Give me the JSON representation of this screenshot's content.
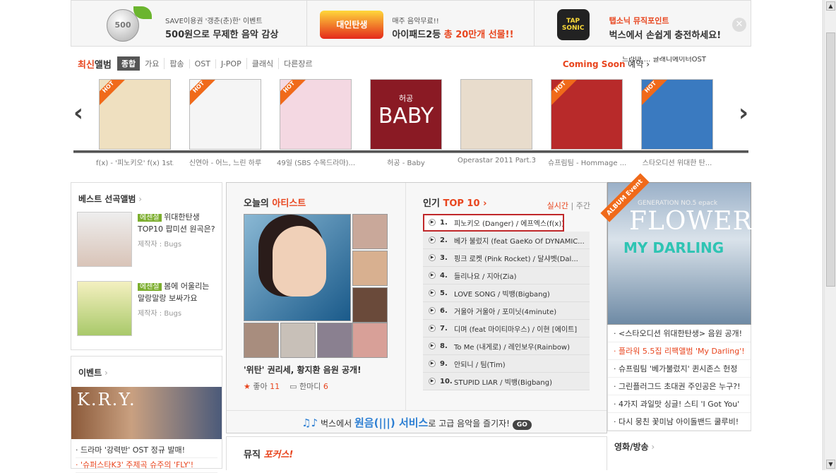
{
  "banner": {
    "coin": "500",
    "item1_small": "SAVE이용권 '갱춘(춘)한' 이벤트",
    "item1_big": "500원으로 무제한 음악 감상",
    "item2_logo": "대인탄생",
    "item2_small": "매주 음악무료!!",
    "item2_big_pre": "아이패드2등 ",
    "item2_big_hl": "총 20만개 선물!!",
    "item3_logo": "TAP SONIC",
    "item3_small": "탭소닉 뮤직포인트",
    "item3_big": "벅스에서 손쉽게 충전하세요!",
    "close": "✕"
  },
  "newest": {
    "title_hl": "최신",
    "title": "앨범",
    "tabs": [
      "종합",
      "가요",
      "팝송",
      "OST",
      "J-POP",
      "클래식",
      "다른장르"
    ],
    "coming_soon": "Coming Soon",
    "coming_soon_suffix": " 예약 ›",
    "ost_text": "드라마 ...\n글래디에이터OST"
  },
  "albums": [
    {
      "caption": "f(x) - '피노키오' f(x) 1st...",
      "hot": "HOT",
      "color": "#efe0c0"
    },
    {
      "caption": "신연아 - 어느, 느린 하루",
      "hot": "HOT",
      "color": "#f5f5f5"
    },
    {
      "caption": "49일 (SBS 수목드라마)...",
      "hot": "HOT",
      "color": "#f4d8e2"
    },
    {
      "caption": "허공 - Baby",
      "hot": "",
      "color": "#8a1a24"
    },
    {
      "caption": "Operastar 2011 Part.3(...",
      "hot": "",
      "color": "#e8dccc"
    },
    {
      "caption": "슈프림팀 - Hommage ...",
      "hot": "HOT",
      "color": "#b82a2a"
    },
    {
      "caption": "스타오디션 위대한 탄...",
      "hot": "HOT",
      "color": "#3a7ac0"
    }
  ],
  "album_cover_text": {
    "baby": "BABY",
    "baby_top": "허공"
  },
  "nav": {
    "prev": "‹",
    "next": "›"
  },
  "best": {
    "title": "베스트 선곡앨범",
    "items": [
      {
        "tag": "에센셜",
        "text": " 위대한탄생 TOP10 팝미션 원곡은?",
        "maker": "제작자 : Bugs"
      },
      {
        "tag": "에센셜",
        "text": " 봄에 어울리는 말랑말랑 보싸가요",
        "maker": "제작자 : Bugs"
      }
    ]
  },
  "events": {
    "title": "이벤트",
    "image_text": "K.R.Y.",
    "items": [
      "드라마 '강력반' OST 정규 발매!",
      "'슈퍼스타K3' 주제곡 슈주의 'FLY'!"
    ]
  },
  "artist": {
    "title_pre": "오늘의 ",
    "title_hl": "아티스트",
    "caption": "'위탄' 권리세, 황지환 음원 공개!",
    "like_label": "좋아",
    "likes": "11",
    "comment_label": "한마디",
    "comments": "6"
  },
  "top10": {
    "title_pre": "인기 ",
    "title_hl": "TOP 10",
    "arrow": "›",
    "opt_realtime": "실시간",
    "opt_weekly": "주간",
    "rows": [
      {
        "rank": "1.",
        "title": "피노키오 (Danger) / 에프엑스(f(x))"
      },
      {
        "rank": "2.",
        "title": "베가 불렀지 (feat GaeKo Of DYNAMIC..."
      },
      {
        "rank": "3.",
        "title": "핑크 로켓 (Pink Rocket) / 달샤벳(Dal..."
      },
      {
        "rank": "4.",
        "title": "들리나요 / 지아(Zia)"
      },
      {
        "rank": "5.",
        "title": "LOVE SONG / 빅뱅(Bigbang)"
      },
      {
        "rank": "6.",
        "title": "거울아 거울아 / 포미닛(4minute)"
      },
      {
        "rank": "7.",
        "title": "디며 (feat 마이티마우스) / 이현 [에이트]"
      },
      {
        "rank": "8.",
        "title": "To Me (내게로) / 레인보우(Rainbow)"
      },
      {
        "rank": "9.",
        "title": "안되니 / 팀(Tim)"
      },
      {
        "rank": "10.",
        "title": "STUPID LIAR / 빅뱅(Bigbang)"
      }
    ]
  },
  "promo": {
    "notes": "♫♪",
    "pre": "벅스에서 ",
    "hl1": "원음(",
    "hl2": ") 서비스",
    "post": "로 고급 음악을 즐기자!",
    "go": "GO"
  },
  "music_focus": {
    "title": "뮤직 ",
    "title_hl": "포커스!"
  },
  "right": {
    "event_tag": "ALBUM Event",
    "gen_text": "GENERATION NO.5 epack",
    "flower": "FLOWER",
    "my_darling": "MY DARLING",
    "news": [
      {
        "text": "<스타오디션 위대한탄생> 음원 공개!",
        "orange": false
      },
      {
        "text": "플라워 5.5집 리팩앨범 'My Darling'!",
        "orange": true
      },
      {
        "text": "슈프림팀 '베가불렀지' 퀸시존스 헌정",
        "orange": false
      },
      {
        "text": "그린플러그드 초대권 주인공은 누구?!",
        "orange": false
      },
      {
        "text": "4가지 과일맛 싱글! 스티 'I Got You'",
        "orange": false
      },
      {
        "text": "다시 뭉친 꽃미남 아이돌밴드 쿨루비!",
        "orange": false
      }
    ],
    "movie_title": "영화/방송"
  }
}
